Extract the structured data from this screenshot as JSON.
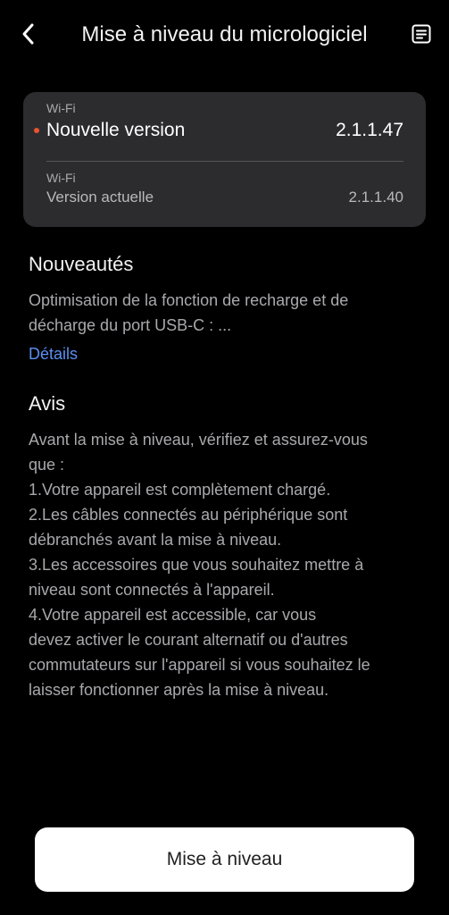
{
  "header": {
    "title": "Mise à niveau du micrologiciel",
    "back_icon": "chevron-left-icon",
    "log_icon": "document-list-icon"
  },
  "version_card": {
    "new_version": {
      "tag": "Wi-Fi",
      "label": "Nouvelle version",
      "value": "2.1.1.47",
      "indicator_color": "#e8532f"
    },
    "current_version": {
      "tag": "Wi-Fi",
      "label": "Version actuelle",
      "value": "2.1.1.40"
    }
  },
  "news": {
    "title": "Nouveautés",
    "lines": [
      "Optimisation de la fonction de recharge et de",
      "décharge du port USB-C : ..."
    ],
    "details_link": "Détails"
  },
  "notice": {
    "title": "Avis",
    "lines": [
      "Avant la mise à niveau, vérifiez et assurez-vous",
      "que :",
      "1.Votre appareil est complètement chargé.",
      "2.Les câbles connectés au périphérique sont",
      "débranchés avant la mise à niveau.",
      "3.Les accessoires que vous souhaitez mettre à",
      "niveau sont connectés à l'appareil.",
      "4.Votre appareil est accessible, car vous",
      "devez activer le courant alternatif ou d'autres",
      "commutateurs sur l'appareil si vous souhaitez le",
      "laisser fonctionner après la mise à niveau."
    ]
  },
  "upgrade_button": {
    "label": "Mise à niveau"
  },
  "colors": {
    "background": "#000000",
    "card": "#2c2c2e",
    "link": "#5b8ff0",
    "button": "#ffffff"
  }
}
